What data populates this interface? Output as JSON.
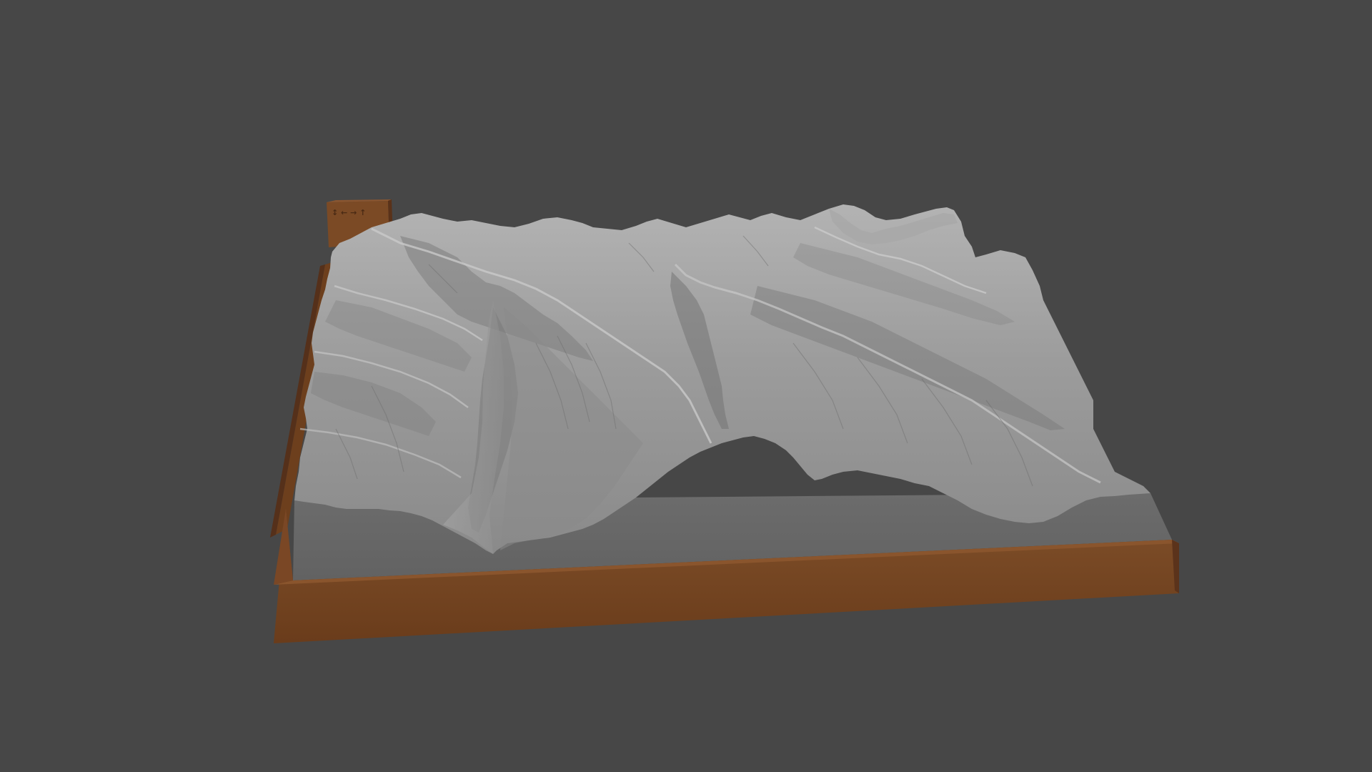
{
  "viewport": {
    "background_color": "#474747"
  },
  "model": {
    "terrain_color": "#9a9a9a",
    "terrain_shadow_color": "#5e5e5e",
    "terrain_highlight_color": "#c6c6c6",
    "base_color": "#7a4a24",
    "base_front_color": "#6b3d1c",
    "base_side_color": "#56301a",
    "plate_color": "#6b6b6b",
    "tab_label_glyphs": "↕ ← → ↑"
  }
}
